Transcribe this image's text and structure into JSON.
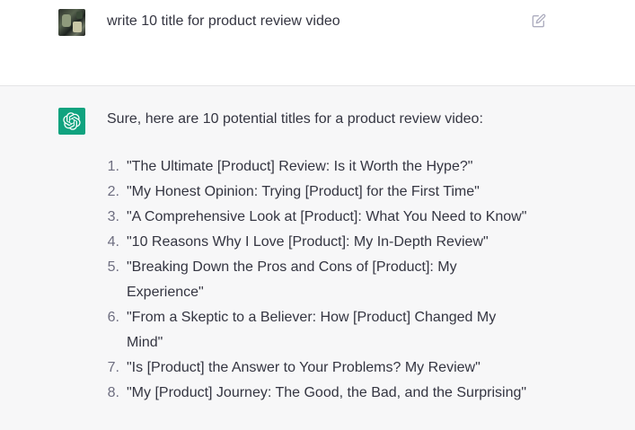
{
  "conversation": {
    "user_message": {
      "avatar": "user-avatar",
      "text": "write 10 title for product review video",
      "edit_icon": "edit-icon"
    },
    "assistant_message": {
      "avatar": "chatgpt-logo-icon",
      "intro": "Sure, here are 10 potential titles for a product review video:",
      "titles": [
        {
          "num": "1.",
          "text": "\"The Ultimate [Product] Review: Is it Worth the Hype?\""
        },
        {
          "num": "2.",
          "text": "\"My Honest Opinion: Trying [Product] for the First Time\""
        },
        {
          "num": "3.",
          "text": "\"A Comprehensive Look at [Product]: What You Need to Know\""
        },
        {
          "num": "4.",
          "text": "\"10 Reasons Why I Love [Product]: My In-Depth Review\""
        },
        {
          "num": "5.",
          "text": "\"Breaking Down the Pros and Cons of [Product]: My Experience\""
        },
        {
          "num": "6.",
          "text": "\"From a Skeptic to a Believer: How [Product] Changed My Mind\""
        },
        {
          "num": "7.",
          "text": "\"Is [Product] the Answer to Your Problems? My Review\""
        },
        {
          "num": "8.",
          "text": "\"My [Product] Journey: The Good, the Bad, and the Surprising\""
        }
      ]
    }
  },
  "colors": {
    "assistant_background": "#f7f7f8",
    "brand_green": "#10a37f",
    "text": "#343541"
  }
}
